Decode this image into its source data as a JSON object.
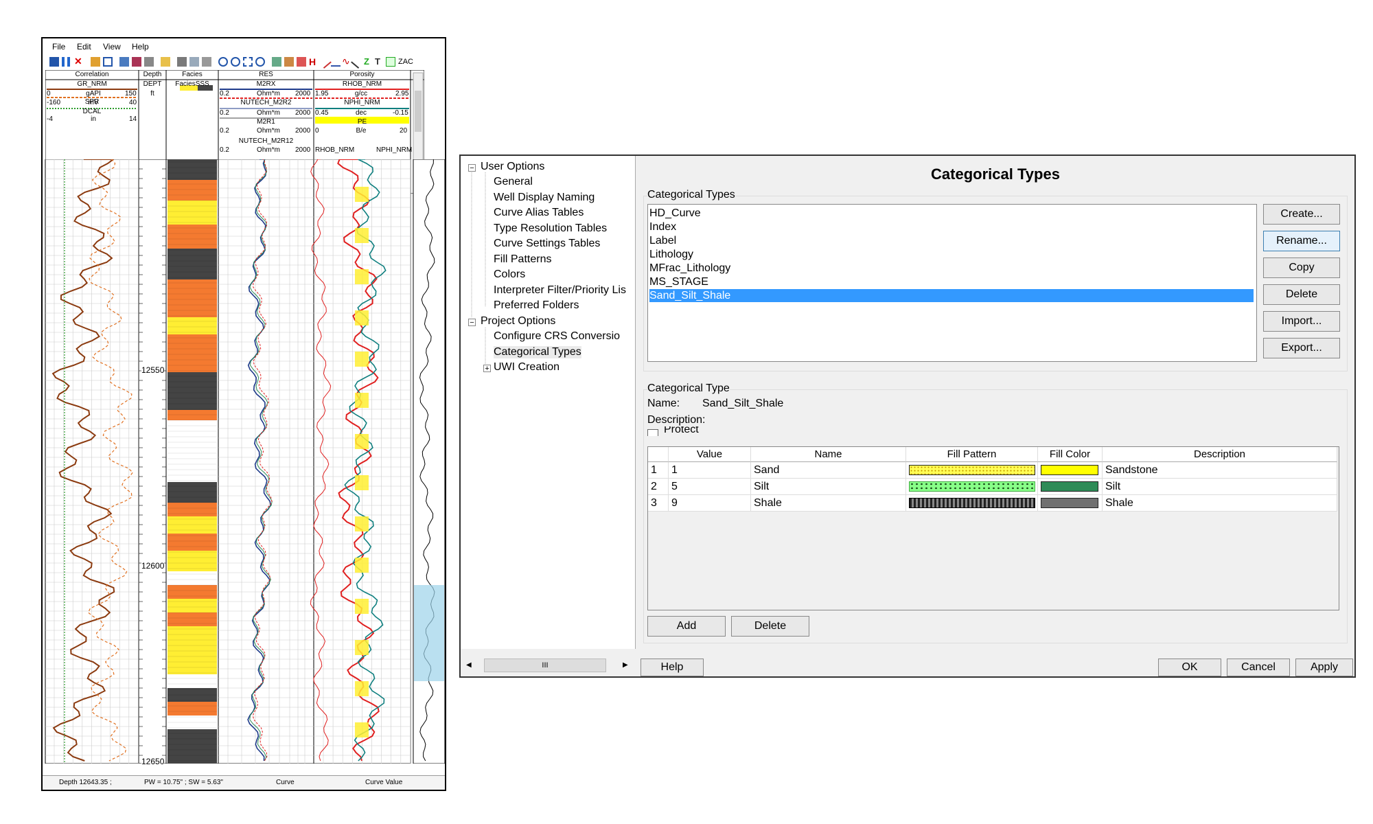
{
  "log_window": {
    "menu": [
      "File",
      "Edit",
      "View",
      "Help"
    ],
    "toolbar_text": "ZAC",
    "tracks": [
      {
        "title": "Correlation",
        "curves": [
          {
            "name": "GR_NRM",
            "min": "0",
            "unit": "gAPI",
            "max": "150"
          },
          {
            "name": "SPR",
            "min": "-160",
            "unit": "mV",
            "max": "40"
          },
          {
            "name": "DCAL",
            "min": "-4",
            "unit": "in",
            "max": "14"
          }
        ]
      },
      {
        "title": "Depth",
        "curves": [
          {
            "name": "DEPT",
            "unit": "ft"
          }
        ]
      },
      {
        "title": "Facies",
        "curves": [
          {
            "name": "FaciesSSS"
          }
        ]
      },
      {
        "title": "RES",
        "curves": [
          {
            "name": "M2RX",
            "min": "0.2",
            "unit": "Ohm*m",
            "max": "2000"
          },
          {
            "name": "NUTECH_M2R2",
            "min": "0.2",
            "unit": "Ohm*m",
            "max": "2000"
          },
          {
            "name": "M2R1",
            "min": "0.2",
            "unit": "Ohm*m",
            "max": "2000"
          },
          {
            "name": "NUTECH_M2R12",
            "min": "0.2",
            "unit": "Ohm*m",
            "max": "2000"
          }
        ]
      },
      {
        "title": "Porosity",
        "curves": [
          {
            "name": "RHOB_NRM",
            "min": "1.95",
            "unit": "g/cc",
            "max": "2.95"
          },
          {
            "name": "NPHI_NRM",
            "min": "0.45",
            "unit": "dec",
            "max": "-0.15"
          },
          {
            "name": "PE",
            "min": "0",
            "unit": "B/e",
            "max": "20"
          }
        ],
        "fill_labels": [
          "RHOB_NRM",
          "NPHI_NRM"
        ]
      }
    ],
    "depth_labels": [
      "12550",
      "12600",
      "12650"
    ],
    "status": {
      "depth": "Depth 12643.35 ;",
      "pw": "PW = 10.75\" ; SW = 5.63\"",
      "curve": "Curve",
      "curve_value": "Curve Value"
    }
  },
  "dialog": {
    "tree": {
      "user_options": "User Options",
      "user_children": [
        "General",
        "Well Display Naming",
        "Curve Alias Tables",
        "Type Resolution Tables",
        "Curve Settings Tables",
        "Fill Patterns",
        "Colors",
        "Interpreter Filter/Priority Lis",
        "Preferred Folders"
      ],
      "project_options": "Project Options",
      "project_children": [
        "Configure CRS Conversio",
        "Categorical Types",
        "UWI Creation"
      ],
      "scroll_thumb": "III"
    },
    "title": "Categorical Types",
    "types_group_label": "Categorical Types",
    "types": [
      "HD_Curve",
      "Index",
      "Label",
      "Lithology",
      "MFrac_Lithology",
      "MS_STAGE",
      "Sand_Silt_Shale"
    ],
    "selected_type": "Sand_Silt_Shale",
    "buttons": {
      "create": "Create...",
      "rename": "Rename...",
      "copy": "Copy",
      "delete": "Delete",
      "import": "Import...",
      "export": "Export..."
    },
    "type_group_label": "Categorical Type",
    "name_label": "Name:",
    "name_value": "Sand_Silt_Shale",
    "description_label": "Description:",
    "protect_label": "Protect",
    "grid_headers": [
      "Value",
      "Name",
      "Fill Pattern",
      "Fill Color",
      "Description"
    ],
    "grid_rows": [
      {
        "row": "1",
        "value": "1",
        "name": "Sand",
        "color": "#ffff00",
        "pattern_bg": "#ffff55",
        "description": "Sandstone"
      },
      {
        "row": "2",
        "value": "5",
        "name": "Silt",
        "color": "#2e8b57",
        "pattern_bg": "#88ff88",
        "description": "Silt"
      },
      {
        "row": "3",
        "value": "9",
        "name": "Shale",
        "color": "#707070",
        "pattern_bg": "#555555",
        "description": "Shale"
      }
    ],
    "add_button": "Add",
    "delete_row_button": "Delete",
    "help_button": "Help",
    "ok_button": "OK",
    "cancel_button": "Cancel",
    "apply_button": "Apply"
  },
  "colors": {
    "gr_curve": "#8b3a0f",
    "spr_curve": "#e07020",
    "dcal_curve": "#2a9a2a",
    "sand": "#ffee33",
    "shale_zone": "#f47a30",
    "res_curve": "#1e3a8a",
    "rhob_curve": "#e02020",
    "nphi_curve": "#0f7f7f",
    "selection": "#3399ff"
  }
}
